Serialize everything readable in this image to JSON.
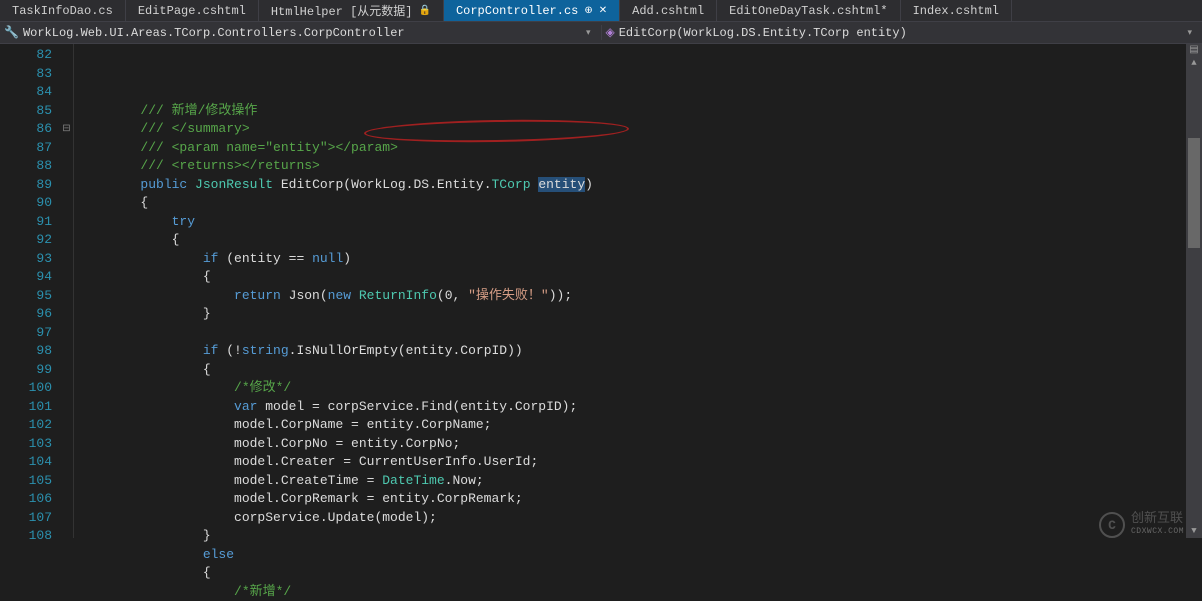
{
  "tabs": [
    {
      "label": "TaskInfoDao.cs",
      "active": false
    },
    {
      "label": "EditPage.cshtml",
      "active": false
    },
    {
      "label": "HtmlHelper [从元数据]",
      "active": false,
      "locked": true
    },
    {
      "label": "CorpController.cs",
      "active": true,
      "pinned": true
    },
    {
      "label": "Add.cshtml",
      "active": false
    },
    {
      "label": "EditOneDayTask.cshtml*",
      "active": false
    },
    {
      "label": "Index.cshtml",
      "active": false
    }
  ],
  "nav": {
    "left": "WorkLog.Web.UI.Areas.TCorp.Controllers.CorpController",
    "right": "EditCorp(WorkLog.DS.Entity.TCorp entity)"
  },
  "line_start": 82,
  "line_end": 108,
  "fold_marker_line": 86,
  "code_lines": [
    {
      "n": 82,
      "tokens": [
        {
          "t": "        ",
          "c": "plain"
        },
        {
          "t": "/// 新增/修改操作",
          "c": "comment"
        }
      ]
    },
    {
      "n": 83,
      "tokens": [
        {
          "t": "        ",
          "c": "plain"
        },
        {
          "t": "/// </summary>",
          "c": "comment"
        }
      ]
    },
    {
      "n": 84,
      "tokens": [
        {
          "t": "        ",
          "c": "plain"
        },
        {
          "t": "/// <param name=\"entity\"></param>",
          "c": "comment"
        }
      ]
    },
    {
      "n": 85,
      "tokens": [
        {
          "t": "        ",
          "c": "plain"
        },
        {
          "t": "/// <returns></returns>",
          "c": "comment"
        }
      ]
    },
    {
      "n": 86,
      "tokens": [
        {
          "t": "        ",
          "c": "plain"
        },
        {
          "t": "public",
          "c": "key"
        },
        {
          "t": " ",
          "c": "plain"
        },
        {
          "t": "JsonResult",
          "c": "type"
        },
        {
          "t": " EditCorp(WorkLog.DS.Entity.",
          "c": "plain"
        },
        {
          "t": "TCorp",
          "c": "type"
        },
        {
          "t": " ",
          "c": "plain"
        },
        {
          "t": "entity",
          "c": "plain",
          "sel": true
        },
        {
          "t": ")",
          "c": "plain"
        }
      ]
    },
    {
      "n": 87,
      "tokens": [
        {
          "t": "        {",
          "c": "plain"
        }
      ]
    },
    {
      "n": 88,
      "tokens": [
        {
          "t": "            ",
          "c": "plain"
        },
        {
          "t": "try",
          "c": "key"
        }
      ]
    },
    {
      "n": 89,
      "tokens": [
        {
          "t": "            {",
          "c": "plain"
        }
      ]
    },
    {
      "n": 90,
      "tokens": [
        {
          "t": "                ",
          "c": "plain"
        },
        {
          "t": "if",
          "c": "key"
        },
        {
          "t": " (entity == ",
          "c": "plain"
        },
        {
          "t": "null",
          "c": "key"
        },
        {
          "t": ")",
          "c": "plain"
        }
      ]
    },
    {
      "n": 91,
      "tokens": [
        {
          "t": "                {",
          "c": "plain"
        }
      ]
    },
    {
      "n": 92,
      "tokens": [
        {
          "t": "                    ",
          "c": "plain"
        },
        {
          "t": "return",
          "c": "key"
        },
        {
          "t": " Json(",
          "c": "plain"
        },
        {
          "t": "new",
          "c": "key"
        },
        {
          "t": " ",
          "c": "plain"
        },
        {
          "t": "ReturnInfo",
          "c": "type"
        },
        {
          "t": "(0, ",
          "c": "plain"
        },
        {
          "t": "\"操作失败！\"",
          "c": "str"
        },
        {
          "t": "));",
          "c": "plain"
        }
      ]
    },
    {
      "n": 93,
      "tokens": [
        {
          "t": "                }",
          "c": "plain"
        }
      ]
    },
    {
      "n": 94,
      "tokens": []
    },
    {
      "n": 95,
      "tokens": [
        {
          "t": "                ",
          "c": "plain"
        },
        {
          "t": "if",
          "c": "key"
        },
        {
          "t": " (!",
          "c": "plain"
        },
        {
          "t": "string",
          "c": "key"
        },
        {
          "t": ".IsNullOrEmpty(entity.CorpID))",
          "c": "plain"
        }
      ]
    },
    {
      "n": 96,
      "tokens": [
        {
          "t": "                {",
          "c": "plain"
        }
      ]
    },
    {
      "n": 97,
      "tokens": [
        {
          "t": "                    ",
          "c": "plain"
        },
        {
          "t": "/*修改*/",
          "c": "comment"
        }
      ]
    },
    {
      "n": 98,
      "tokens": [
        {
          "t": "                    ",
          "c": "plain"
        },
        {
          "t": "var",
          "c": "key"
        },
        {
          "t": " model = corpService.Find(entity.CorpID);",
          "c": "plain"
        }
      ]
    },
    {
      "n": 99,
      "tokens": [
        {
          "t": "                    model.CorpName = entity.CorpName;",
          "c": "plain"
        }
      ]
    },
    {
      "n": 100,
      "tokens": [
        {
          "t": "                    model.CorpNo = entity.CorpNo;",
          "c": "plain"
        }
      ]
    },
    {
      "n": 101,
      "tokens": [
        {
          "t": "                    model.Creater = CurrentUserInfo.UserId;",
          "c": "plain"
        }
      ]
    },
    {
      "n": 102,
      "tokens": [
        {
          "t": "                    model.CreateTime = ",
          "c": "plain"
        },
        {
          "t": "DateTime",
          "c": "type"
        },
        {
          "t": ".Now;",
          "c": "plain"
        }
      ]
    },
    {
      "n": 103,
      "tokens": [
        {
          "t": "                    model.CorpRemark = entity.CorpRemark;",
          "c": "plain"
        }
      ]
    },
    {
      "n": 104,
      "tokens": [
        {
          "t": "                    corpService.Update(model);",
          "c": "plain"
        }
      ]
    },
    {
      "n": 105,
      "tokens": [
        {
          "t": "                }",
          "c": "plain"
        }
      ]
    },
    {
      "n": 106,
      "tokens": [
        {
          "t": "                ",
          "c": "plain"
        },
        {
          "t": "else",
          "c": "key"
        }
      ]
    },
    {
      "n": 107,
      "tokens": [
        {
          "t": "                {",
          "c": "plain"
        }
      ]
    },
    {
      "n": 108,
      "tokens": [
        {
          "t": "                    ",
          "c": "plain"
        },
        {
          "t": "/*新增*/",
          "c": "comment"
        }
      ]
    }
  ],
  "watermark": {
    "logo": "C",
    "cn": "创新互联",
    "en": "CDXWCX.COM"
  }
}
